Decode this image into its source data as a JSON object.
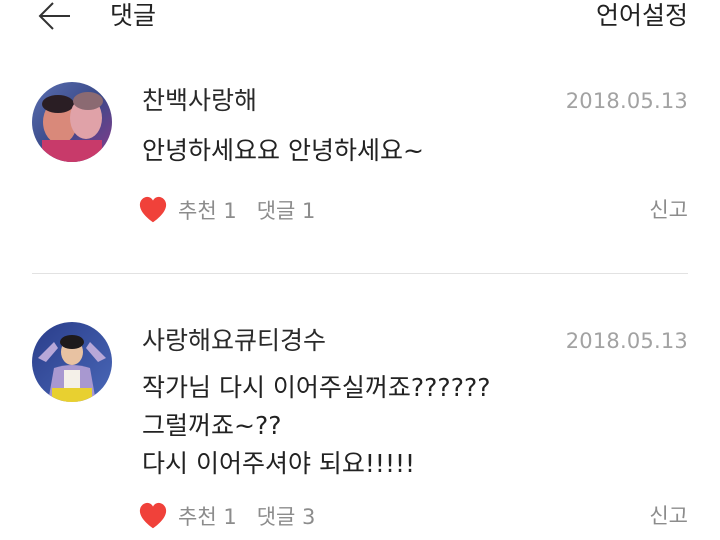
{
  "header": {
    "title": "댓글",
    "language_setting": "언어설정",
    "back_icon": "arrow-left-icon"
  },
  "comments": [
    {
      "username": "찬백사랑해",
      "date": "2018.05.13",
      "body": "안녕하세요요 안녕하세요~",
      "like_label": "추천 1",
      "reply_label": "댓글 1",
      "report_label": "신고"
    },
    {
      "username": "사랑해요큐티경수",
      "date": "2018.05.13",
      "body": "작가님 다시 이어주실꺼죠??????\n그럴꺼죠~??\n다시 이어주셔야 되요!!!!!",
      "like_label": "추천 1",
      "reply_label": "댓글 3",
      "report_label": "신고"
    }
  ],
  "colors": {
    "heart": "#f0413a",
    "meta_text": "#8c8c8c",
    "date_text": "#a2a2a2",
    "divider": "#e2e2e2"
  }
}
